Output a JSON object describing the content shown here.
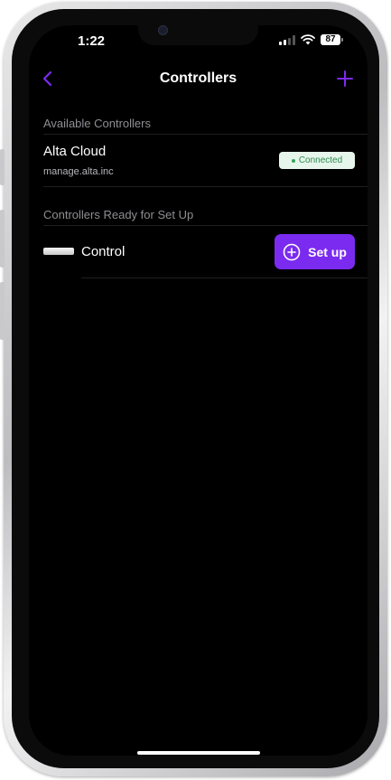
{
  "status_bar": {
    "time": "1:22",
    "battery": "87"
  },
  "nav": {
    "title": "Controllers",
    "back_icon": "chevron-left-icon",
    "add_icon": "plus-icon",
    "accent_color": "#7b2bef"
  },
  "available": {
    "header": "Available Controllers",
    "items": [
      {
        "name": "Alta Cloud",
        "host": "manage.alta.inc",
        "status": "Connected"
      }
    ]
  },
  "ready": {
    "header": "Controllers Ready for Set Up",
    "items": [
      {
        "name": "Control",
        "action_label": "Set up"
      }
    ]
  }
}
